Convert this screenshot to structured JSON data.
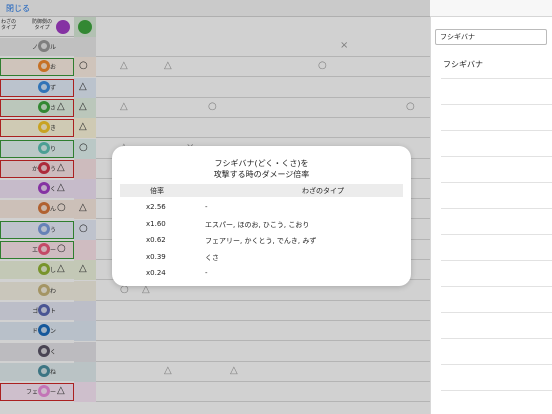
{
  "topbar": {
    "close_label": "閉じる"
  },
  "header": {
    "attack_type_label": "わざの\nタイプ",
    "defense_type_label": "防御側の\nタイプ"
  },
  "types": [
    {
      "name": "ノーマル",
      "color": "#9a9a9a",
      "highlight": "none",
      "mark": "",
      "mark2": "",
      "bg": "#ebebeb"
    },
    {
      "name": "ほのお",
      "color": "#f28a2e",
      "highlight": "green",
      "mark": "",
      "mark2": "○",
      "bg": "#fdf0e4"
    },
    {
      "name": "みず",
      "color": "#3c8ee0",
      "highlight": "red",
      "mark": "",
      "mark2": "△",
      "bg": "#e4eefb"
    },
    {
      "name": "くさ",
      "color": "#3fa63f",
      "highlight": "red",
      "mark": "△",
      "mark2": "△",
      "bg": "#e5f3e5"
    },
    {
      "name": "でんき",
      "color": "#f5c72b",
      "highlight": "red",
      "mark": "",
      "mark2": "△",
      "bg": "#fdf7dc"
    },
    {
      "name": "こおり",
      "color": "#5cc2b5",
      "highlight": "green",
      "mark": "",
      "mark2": "○",
      "bg": "#e3f4f2"
    },
    {
      "name": "かくとう",
      "color": "#d33548",
      "highlight": "red",
      "mark": "△",
      "mark2": "",
      "bg": "#fbe4e7"
    },
    {
      "name": "どく",
      "color": "#a33ec7",
      "highlight": "none",
      "mark": "△",
      "mark2": "",
      "bg": "#f2e4f7"
    },
    {
      "name": "じめん",
      "color": "#d8773b",
      "highlight": "none",
      "mark": "○",
      "mark2": "△",
      "bg": "#f9ebe1"
    },
    {
      "name": "ひこう",
      "color": "#7d9fe0",
      "highlight": "green",
      "mark": "",
      "mark2": "○",
      "bg": "#e9eefb"
    },
    {
      "name": "エスパー",
      "color": "#f05a7e",
      "highlight": "green",
      "mark": "○",
      "mark2": "",
      "bg": "#fde6ec"
    },
    {
      "name": "むし",
      "color": "#93b535",
      "highlight": "none",
      "mark": "△",
      "mark2": "△",
      "bg": "#eef4df"
    },
    {
      "name": "いわ",
      "color": "#c9b67a",
      "highlight": "none",
      "mark": "",
      "mark2": "",
      "bg": "#f6f2e4"
    },
    {
      "name": "ゴースト",
      "color": "#5968b4",
      "highlight": "none",
      "mark": "",
      "mark2": "",
      "bg": "#e6e8f4"
    },
    {
      "name": "ドラゴン",
      "color": "#1a6cbd",
      "highlight": "none",
      "mark": "",
      "mark2": "",
      "bg": "#e1ebf6"
    },
    {
      "name": "あく",
      "color": "#5a5366",
      "highlight": "none",
      "mark": "",
      "mark2": "",
      "bg": "#e6e5e9"
    },
    {
      "name": "はがね",
      "color": "#4a8fa0",
      "highlight": "none",
      "mark": "",
      "mark2": "",
      "bg": "#e3eef1"
    },
    {
      "name": "フェアリー",
      "color": "#ee8fe0",
      "highlight": "red",
      "mark": "△",
      "mark2": "",
      "bg": "#fceaf9"
    }
  ],
  "matrix_rows": [
    [
      "",
      "",
      "",
      "",
      "",
      "",
      "",
      "",
      "",
      "",
      "×",
      "",
      "",
      ""
    ],
    [
      "△",
      "",
      "△",
      "",
      "",
      "",
      "",
      "",
      "",
      "○",
      "",
      "",
      "",
      ""
    ],
    [
      "",
      "",
      "",
      "",
      "",
      "",
      "",
      "",
      "",
      "",
      "",
      "",
      "",
      ""
    ],
    [
      "△",
      "",
      "",
      "",
      "○",
      "",
      "",
      "",
      "",
      "",
      "",
      "",
      "",
      "○"
    ],
    [
      "",
      "",
      "",
      "",
      "",
      "",
      "",
      "",
      "",
      "",
      "",
      "",
      "",
      ""
    ],
    [
      "△",
      "",
      "",
      "×",
      "",
      "",
      "",
      "",
      "",
      "",
      "",
      "",
      "",
      ""
    ],
    [
      "",
      "",
      "",
      "",
      "",
      "",
      "",
      "",
      "",
      "",
      "",
      "",
      "",
      ""
    ],
    [
      "",
      "",
      "",
      "",
      "",
      "",
      "",
      "",
      "",
      "",
      "",
      "",
      "",
      ""
    ],
    [
      "",
      "",
      "",
      "",
      "",
      "",
      "",
      "",
      "",
      "",
      "",
      "",
      "",
      ""
    ],
    [
      "",
      "",
      "",
      "",
      "",
      "",
      "",
      "",
      "",
      "",
      "",
      "",
      "",
      ""
    ],
    [
      "○",
      "",
      "",
      "",
      "",
      "",
      "",
      "",
      "",
      "",
      "",
      "",
      "",
      ""
    ],
    [
      "",
      "",
      "",
      "",
      "",
      "",
      "",
      "",
      "",
      "",
      "",
      "",
      "",
      ""
    ],
    [
      "○",
      "△",
      "",
      "",
      "",
      "",
      "",
      "",
      "",
      "",
      "",
      "",
      "",
      ""
    ],
    [
      "",
      "",
      "",
      "",
      "",
      "",
      "",
      "",
      "",
      "",
      "",
      "",
      "",
      ""
    ],
    [
      "",
      "",
      "",
      "",
      "",
      "",
      "",
      "",
      "",
      "",
      "",
      "",
      "",
      ""
    ],
    [
      "",
      "",
      "",
      "",
      "",
      "",
      "",
      "",
      "",
      "",
      "",
      "",
      "",
      ""
    ],
    [
      "",
      "",
      "△",
      "",
      "",
      "△",
      "",
      "",
      "",
      "",
      "",
      "",
      "",
      ""
    ],
    [
      "",
      "",
      "",
      "",
      "",
      "",
      "",
      "",
      "",
      "",
      "",
      "",
      "",
      ""
    ]
  ],
  "right_panel": {
    "search_value": "フシギバナ",
    "items": [
      "フシギバナ",
      "",
      "",
      "",
      "",
      "",
      "",
      "",
      "",
      "",
      "",
      "",
      "",
      ""
    ]
  },
  "modal": {
    "title_line1": "フシギバナ(どく・くさ)を",
    "title_line2": "攻撃する時のダメージ倍率",
    "col_rate": "倍率",
    "col_types": "わざのタイプ",
    "rows": [
      {
        "rate": "x2.56",
        "types": "-"
      },
      {
        "rate": "x1.60",
        "types": "エスパー, ほのお, ひこう, こおり"
      },
      {
        "rate": "x0.62",
        "types": "フェアリー, かくとう, でんき, みず"
      },
      {
        "rate": "x0.39",
        "types": "くさ"
      },
      {
        "rate": "x0.24",
        "types": "-"
      }
    ]
  }
}
